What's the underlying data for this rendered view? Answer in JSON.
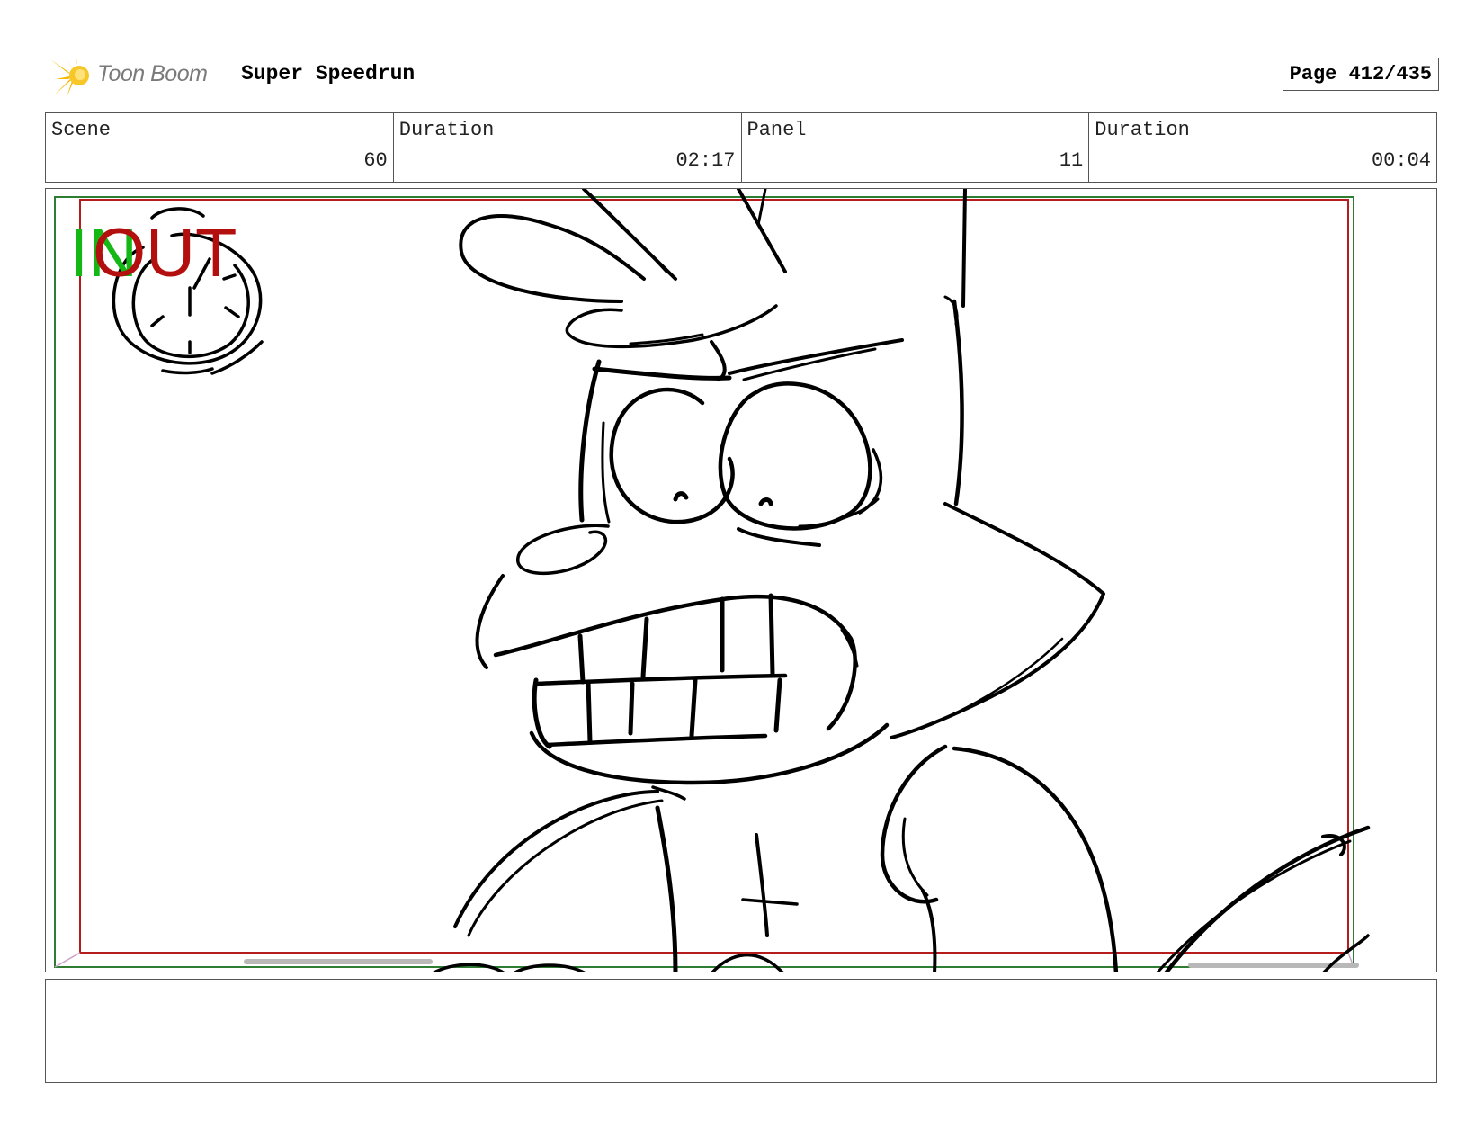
{
  "header": {
    "logo_text": "Toon Boom",
    "project_title": "Super Speedrun",
    "page_label": "Page 412/435"
  },
  "info": {
    "scene_label": "Scene",
    "scene_value": "60",
    "scene_duration_label": "Duration",
    "scene_duration_value": "02:17",
    "panel_label": "Panel",
    "panel_value": "11",
    "panel_duration_label": "Duration",
    "panel_duration_value": "00:04"
  },
  "panel": {
    "in_marker": "IN",
    "out_marker": "OUT"
  },
  "notes": {
    "text": ""
  },
  "colors": {
    "in_marker": "#14b814",
    "out_marker": "#b40f0f",
    "safe_frame_green": "#2e7d32",
    "safe_frame_red": "#b71c1c",
    "logo_star": "#f5b800"
  }
}
